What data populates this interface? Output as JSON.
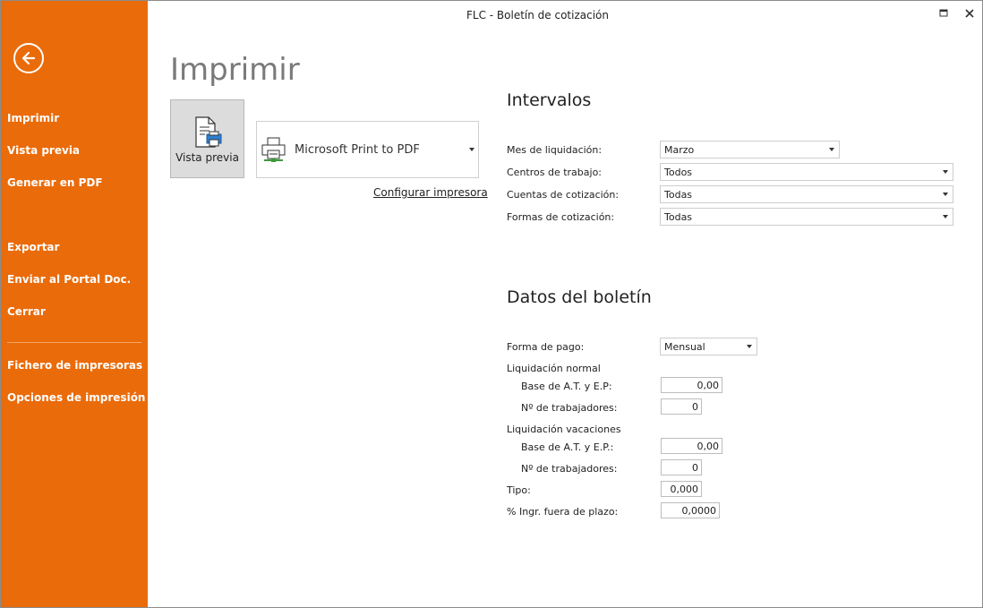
{
  "window": {
    "title": "FLC - Boletín de cotización"
  },
  "sidebar": {
    "items": [
      {
        "label": "Imprimir"
      },
      {
        "label": "Vista previa"
      },
      {
        "label": "Generar en PDF"
      },
      {
        "label": "Exportar"
      },
      {
        "label": "Enviar al Portal Doc."
      },
      {
        "label": "Cerrar"
      },
      {
        "label": "Fichero de impresoras"
      },
      {
        "label": "Opciones de impresión"
      }
    ],
    "accent": "#ea6b0a"
  },
  "main": {
    "heading": "Imprimir",
    "preview_button": "Vista previa",
    "printer": "Microsoft Print to PDF",
    "config_link": "Configurar impresora"
  },
  "intervalos": {
    "title": "Intervalos",
    "mes_label": "Mes de liquidación:",
    "mes_value": "Marzo",
    "centros_label": "Centros de trabajo:",
    "centros_value": "Todos",
    "cuentas_label": "Cuentas de cotización:",
    "cuentas_value": "Todas",
    "formas_label": "Formas de cotización:",
    "formas_value": "Todas"
  },
  "datos": {
    "title": "Datos del boletín",
    "forma_pago_label": "Forma de pago:",
    "forma_pago_value": "Mensual",
    "liq_normal_label": "Liquidación normal",
    "base_normal_label": "Base de A.T. y E.P:",
    "base_normal_value": "0,00",
    "trab_normal_label": "Nº de trabajadores:",
    "trab_normal_value": "0",
    "liq_vac_label": "Liquidación vacaciones",
    "base_vac_label": "Base de A.T. y E.P.:",
    "base_vac_value": "0,00",
    "trab_vac_label": "Nº de trabajadores:",
    "trab_vac_value": "0",
    "tipo_label": "Tipo:",
    "tipo_value": "0,000",
    "ingr_label": "% Ingr. fuera de plazo:",
    "ingr_value": "0,0000"
  }
}
